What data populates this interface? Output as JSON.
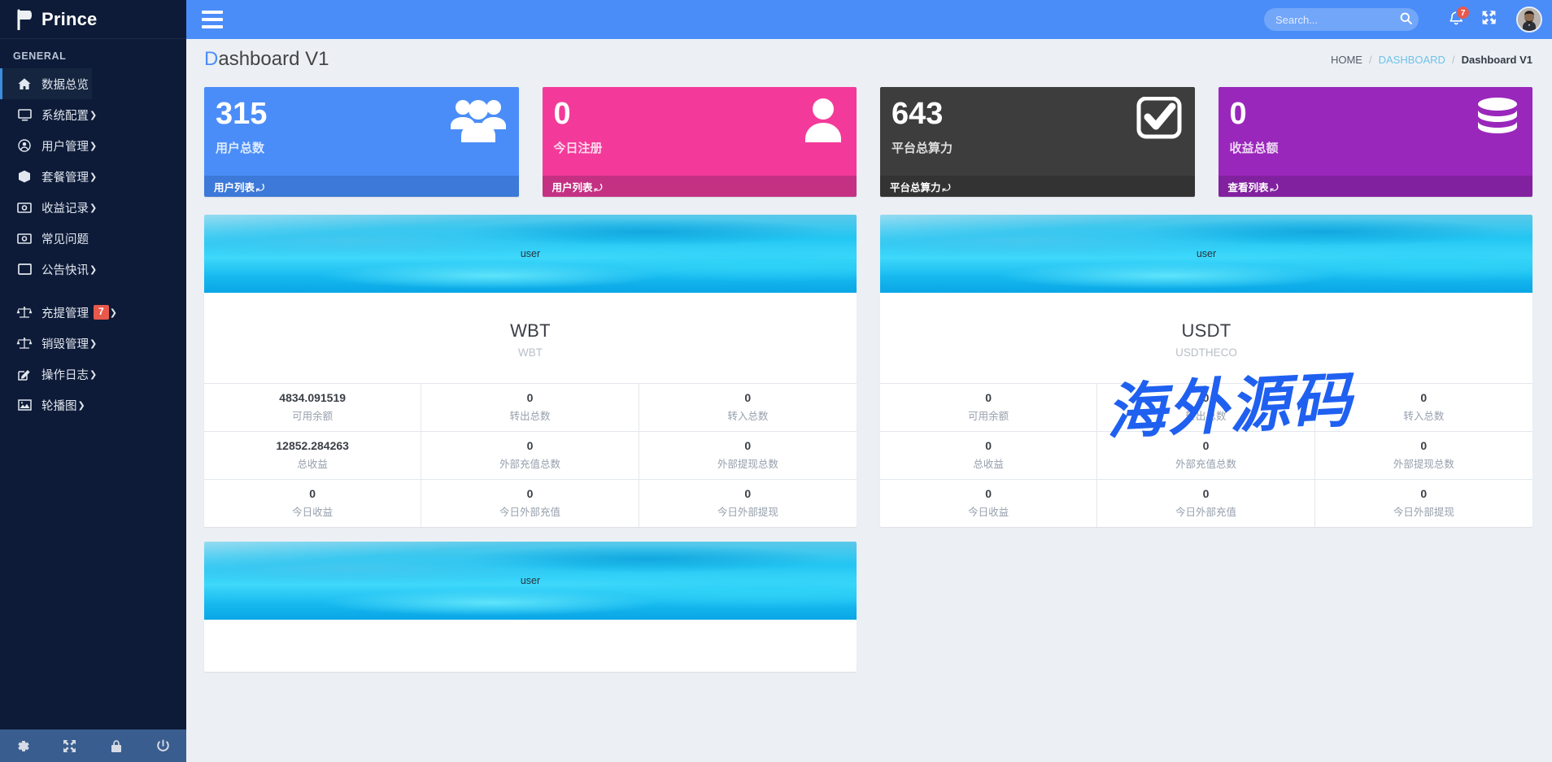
{
  "brand": {
    "name": "Prince",
    "logo_icon": "prince-flag-logo"
  },
  "sidebar": {
    "section_label": "GENERAL",
    "items": [
      {
        "label": "数据总览",
        "icon": "home-icon",
        "active": true,
        "caret": false,
        "badge": null,
        "gap_before": false
      },
      {
        "label": "系统配置",
        "icon": "monitor-icon",
        "active": false,
        "caret": true,
        "badge": null,
        "gap_before": false
      },
      {
        "label": "用户管理",
        "icon": "user-circle-icon",
        "active": false,
        "caret": true,
        "badge": null,
        "gap_before": false
      },
      {
        "label": "套餐管理",
        "icon": "box-icon",
        "active": false,
        "caret": true,
        "badge": null,
        "gap_before": false
      },
      {
        "label": "收益记录",
        "icon": "money-icon",
        "active": false,
        "caret": true,
        "badge": null,
        "gap_before": false
      },
      {
        "label": "常见问题",
        "icon": "money-icon",
        "active": false,
        "caret": false,
        "badge": null,
        "gap_before": false
      },
      {
        "label": "公告快讯",
        "icon": "window-icon",
        "active": false,
        "caret": true,
        "badge": null,
        "gap_before": false
      },
      {
        "label": "充提管理",
        "icon": "balance-scale-icon",
        "active": false,
        "caret": true,
        "badge": "7",
        "gap_before": true
      },
      {
        "label": "销毁管理",
        "icon": "balance-scale-icon",
        "active": false,
        "caret": true,
        "badge": null,
        "gap_before": false
      },
      {
        "label": "操作日志",
        "icon": "edit-square-icon",
        "active": false,
        "caret": true,
        "badge": null,
        "gap_before": false
      },
      {
        "label": "轮播图",
        "icon": "image-icon",
        "active": false,
        "caret": true,
        "badge": null,
        "gap_before": false
      }
    ],
    "footer_icons": [
      "gear-icon",
      "expand-icon",
      "lock-icon",
      "power-icon"
    ],
    "badge_color": "#e8594c",
    "background_color": "#0d1b38",
    "footer_background_color": "#3a5d8f"
  },
  "topbar": {
    "menu_icon": "hamburger-icon",
    "search": {
      "value": "",
      "placeholder": "Search...",
      "icon": "search-icon"
    },
    "notification": {
      "icon": "bell-icon",
      "count": "7"
    },
    "fullscreen_icon": "expand-arrows-icon",
    "avatar_icon": "user-avatar",
    "background_color": "#4b8df8"
  },
  "page": {
    "title_first_letter": "D",
    "title_rest": "ashboard V1",
    "breadcrumb": {
      "home": "HOME",
      "separator": "/",
      "section": "DASHBOARD",
      "current": "Dashboard V1"
    }
  },
  "stats": [
    {
      "value": "315",
      "label": "用户总数",
      "footer_label": "用户列表",
      "footer_icon": "arrow-circle-icon",
      "icon": "users-group-icon",
      "color": "#4b8df8",
      "footer_color": "#3c79d8"
    },
    {
      "value": "0",
      "label": "今日注册",
      "footer_label": "用户列表",
      "footer_icon": "arrow-circle-icon",
      "icon": "user-single-icon",
      "color": "#f33a9a",
      "footer_color": "#c43183"
    },
    {
      "value": "643",
      "label": "平台总算力",
      "footer_label": "平台总算力",
      "footer_icon": "arrow-circle-icon",
      "icon": "check-square-icon",
      "color": "#3d3d3d",
      "footer_color": "#333333"
    },
    {
      "value": "0",
      "label": "收益总额",
      "footer_label": "查看列表",
      "footer_icon": "arrow-circle-icon",
      "icon": "database-icon",
      "color": "#9a27bb",
      "footer_color": "#82219f"
    }
  ],
  "coin_cards": [
    {
      "banner_alt": "user",
      "title": "WBT",
      "subtitle": "WBT",
      "cells": [
        {
          "value": "4834.091519",
          "label": "可用余额"
        },
        {
          "value": "0",
          "label": "转出总数"
        },
        {
          "value": "0",
          "label": "转入总数"
        },
        {
          "value": "12852.284263",
          "label": "总收益"
        },
        {
          "value": "0",
          "label": "外部充值总数"
        },
        {
          "value": "0",
          "label": "外部提现总数"
        },
        {
          "value": "0",
          "label": "今日收益"
        },
        {
          "value": "0",
          "label": "今日外部充值"
        },
        {
          "value": "0",
          "label": "今日外部提现"
        }
      ]
    },
    {
      "banner_alt": "user",
      "title": "USDT",
      "subtitle": "USDTHECO",
      "cells": [
        {
          "value": "0",
          "label": "可用余额"
        },
        {
          "value": "0",
          "label": "转出总数"
        },
        {
          "value": "0",
          "label": "转入总数"
        },
        {
          "value": "0",
          "label": "总收益"
        },
        {
          "value": "0",
          "label": "外部充值总数"
        },
        {
          "value": "0",
          "label": "外部提现总数"
        },
        {
          "value": "0",
          "label": "今日收益"
        },
        {
          "value": "0",
          "label": "今日外部充值"
        },
        {
          "value": "0",
          "label": "今日外部提现"
        }
      ]
    }
  ],
  "partial_card": {
    "banner_alt": "user"
  },
  "watermark": {
    "text": "海外源码",
    "color": "#1f60f0"
  }
}
